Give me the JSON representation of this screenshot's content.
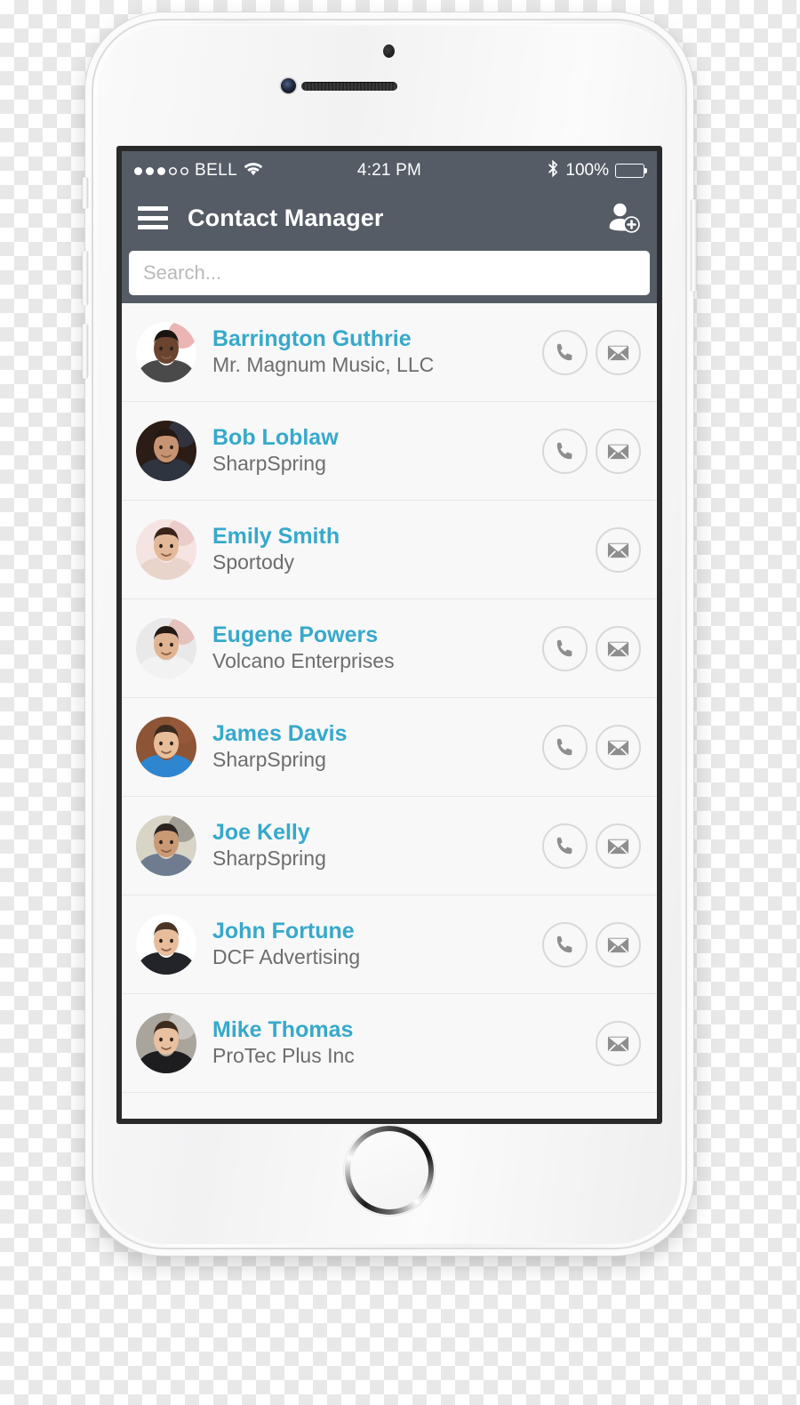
{
  "status_bar": {
    "signal_dots_filled": 3,
    "signal_dots_total": 5,
    "carrier": "BELL",
    "wifi_icon": "wifi-icon",
    "time": "4:21 PM",
    "bluetooth_icon": "bluetooth-icon",
    "battery_percent": "100%",
    "battery_level": 100
  },
  "nav": {
    "menu_icon": "hamburger-icon",
    "title": "Contact Manager",
    "add_contact_icon": "add-contact-icon"
  },
  "search": {
    "placeholder": "Search...",
    "value": ""
  },
  "colors": {
    "header_bg": "#555c66",
    "name_accent": "#36a9cb",
    "company_text": "#6d6d6d",
    "list_bg": "#f8f8f8",
    "divider": "#e6e6e6",
    "icon_gray": "#8e8e8e",
    "icon_ring": "#d8d8d8"
  },
  "contacts": [
    {
      "name": "Barrington Guthrie",
      "company": "Mr. Magnum Music, LLC",
      "has_phone": true,
      "has_email": true,
      "avatar": {
        "skin": "#6b4430",
        "hair": "#1b1410",
        "shirt": "#4a4a4a",
        "bg": "#ffffff",
        "accent": "#c42b22"
      }
    },
    {
      "name": "Bob Loblaw",
      "company": "SharpSpring",
      "has_phone": true,
      "has_email": true,
      "avatar": {
        "skin": "#c69472",
        "hair": "#241812",
        "shirt": "#2e3440",
        "bg": "#2b1d15",
        "accent": "#3b5f8f"
      }
    },
    {
      "name": "Emily Smith",
      "company": "Sportody",
      "has_phone": false,
      "has_email": true,
      "avatar": {
        "skin": "#e4b99a",
        "hair": "#3a2318",
        "shirt": "#e9d4cc",
        "bg": "#f5e4e1",
        "accent": "#d8a0a0"
      }
    },
    {
      "name": "Eugene Powers",
      "company": "Volcano Enterprises",
      "has_phone": true,
      "has_email": true,
      "avatar": {
        "skin": "#e0b392",
        "hair": "#241a14",
        "shirt": "#f2f2f2",
        "bg": "#e9e9e9",
        "accent": "#e07a6a"
      }
    },
    {
      "name": "James Davis",
      "company": "SharpSpring",
      "has_phone": true,
      "has_email": true,
      "avatar": {
        "skin": "#e8bd9a",
        "hair": "#3b2a1e",
        "shirt": "#2e86d0",
        "bg": "#8d5436",
        "accent": "#a5633f"
      }
    },
    {
      "name": "Joe Kelly",
      "company": "SharpSpring",
      "has_phone": true,
      "has_email": true,
      "avatar": {
        "skin": "#c99a74",
        "hair": "#2a2320",
        "shirt": "#6f7c90",
        "bg": "#d8d4c6",
        "accent": "#3a3a3a"
      }
    },
    {
      "name": "John Fortune",
      "company": "DCF Advertising",
      "has_phone": true,
      "has_email": true,
      "avatar": {
        "skin": "#e7bd9c",
        "hair": "#4a3424",
        "shirt": "#23242a",
        "bg": "#ffffff",
        "accent": "#ffffff"
      }
    },
    {
      "name": "Mike Thomas",
      "company": "ProTec Plus Inc",
      "has_phone": false,
      "has_email": true,
      "avatar": {
        "skin": "#e9c0a0",
        "hair": "#3e2a1c",
        "shirt": "#1d1d1f",
        "bg": "#a9a49c",
        "accent": "#ffffff"
      }
    }
  ],
  "action_icons": {
    "phone": "phone-icon",
    "email": "email-icon"
  }
}
